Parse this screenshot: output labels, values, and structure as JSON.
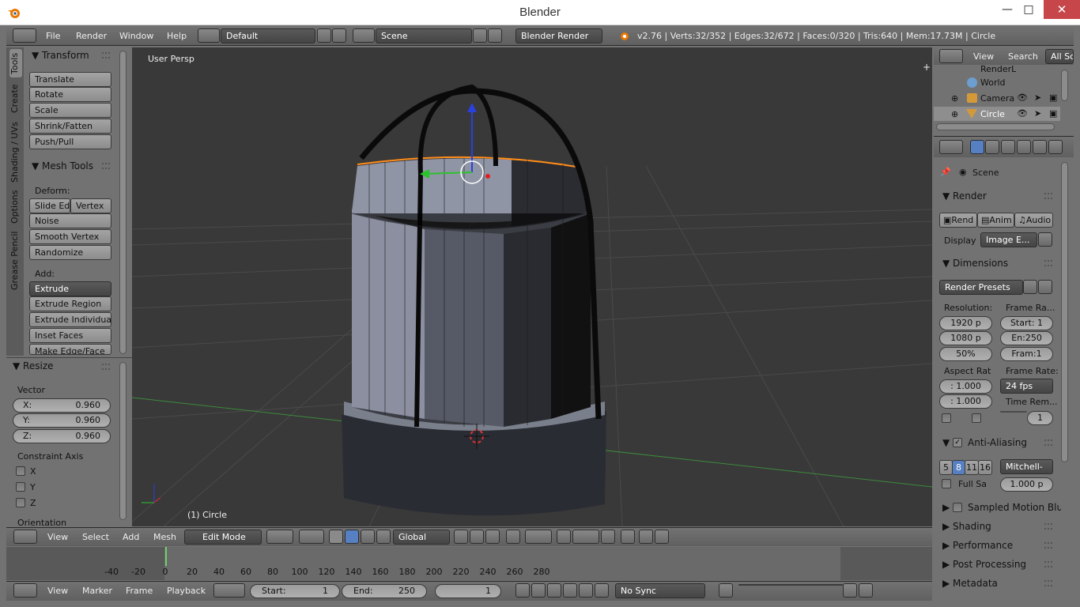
{
  "window": {
    "title": "Blender"
  },
  "top_menu": {
    "items": [
      "File",
      "Render",
      "Window",
      "Help"
    ],
    "layout": "Default",
    "scene": "Scene",
    "engine": "Blender Render",
    "stats": "v2.76 | Verts:32/352 | Edges:32/672 | Faces:0/320 | Tris:640 | Mem:17.73M | Circle"
  },
  "tool_tabs": [
    "Tools",
    "Create",
    "Shading / UVs",
    "Options",
    "Grease Pencil"
  ],
  "tools": {
    "transform_header": "Transform",
    "transform": [
      "Translate",
      "Rotate",
      "Scale",
      "Shrink/Fatten",
      "Push/Pull"
    ],
    "mesh_tools_header": "Mesh Tools",
    "deform_label": "Deform:",
    "slide_edge": "Slide Ed",
    "vertex": "Vertex",
    "deform": [
      "Noise",
      "Smooth Vertex",
      "Randomize"
    ],
    "add_label": "Add:",
    "extrude": "Extrude",
    "add": [
      "Extrude Region",
      "Extrude Individual",
      "Inset Faces",
      "Make Edge/Face"
    ]
  },
  "resize": {
    "header": "Resize",
    "vector_label": "Vector",
    "x": "X:",
    "x_val": "0.960",
    "y": "Y:",
    "y_val": "0.960",
    "z": "Z:",
    "z_val": "0.960",
    "constraint_label": "Constraint Axis",
    "cx": "X",
    "cy": "Y",
    "cz": "Z",
    "orientation_label": "Orientation"
  },
  "viewport": {
    "persp_label": "User Persp",
    "object_label": "(1) Circle"
  },
  "view3d_header": {
    "menus": [
      "View",
      "Select",
      "Add",
      "Mesh"
    ],
    "mode": "Edit Mode",
    "orientation": "Global"
  },
  "timeline": {
    "ticks": [
      "-40",
      "-20",
      "0",
      "20",
      "40",
      "60",
      "80",
      "100",
      "120",
      "140",
      "160",
      "180",
      "200",
      "220",
      "240",
      "260",
      "280"
    ],
    "menus": [
      "View",
      "Marker",
      "Frame",
      "Playback"
    ],
    "start_label": "Start:",
    "start_val": "1",
    "end_label": "End:",
    "end_val": "250",
    "current": "1",
    "sync": "No Sync"
  },
  "outliner": {
    "view": "View",
    "search": "Search",
    "all_scenes": "All Sc",
    "items": [
      "RenderL",
      "World",
      "Camera",
      "Circle"
    ]
  },
  "properties": {
    "scene": "Scene",
    "render_header": "Render",
    "render_btn": "Rend",
    "anim_btn": "Anim",
    "audio_btn": "Audio",
    "display_label": "Display",
    "display_val": "Image E...",
    "dimensions_header": "Dimensions",
    "presets": "Render Presets",
    "resolution_label": "Resolution:",
    "res_x": "1920 p",
    "res_y": "1080 p",
    "res_pct": "50%",
    "frame_range_label": "Frame Ra...",
    "f_start": "Start: 1",
    "f_end": "En:250",
    "f_step": "Fram:1",
    "aspect_label": "Aspect Rat",
    "asp_x": ": 1.000",
    "asp_y": ": 1.000",
    "frame_rate_label": "Frame Rate:",
    "fps": "24 fps",
    "time_remap_label": "Time Rem...",
    "time_remap_val": "1",
    "aa_header": "Anti-Aliasing",
    "aa_samples": [
      "5",
      "8",
      "11",
      "16"
    ],
    "aa_filter": "Mitchell-",
    "full_sample": "Full Sa",
    "aa_size": "1.000 p",
    "collapsed": [
      "Sampled Motion Blur",
      "Shading",
      "Performance",
      "Post Processing",
      "Metadata"
    ]
  },
  "colors": {
    "selection": "#ff8c1a",
    "accent": "#5680c2",
    "viewport_bg": "#393939"
  }
}
